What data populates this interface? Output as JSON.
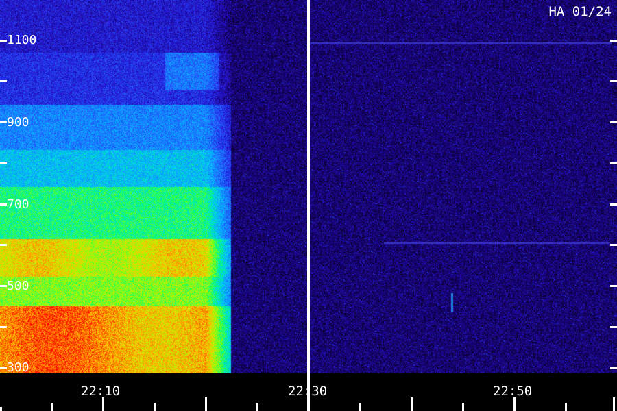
{
  "title": "HA 01/24",
  "y_axis": {
    "labels": [
      "1100",
      "900",
      "700",
      "500",
      "300"
    ]
  },
  "x_axis": {
    "labels": [
      "22:10",
      "22:30",
      "22:50"
    ]
  }
}
